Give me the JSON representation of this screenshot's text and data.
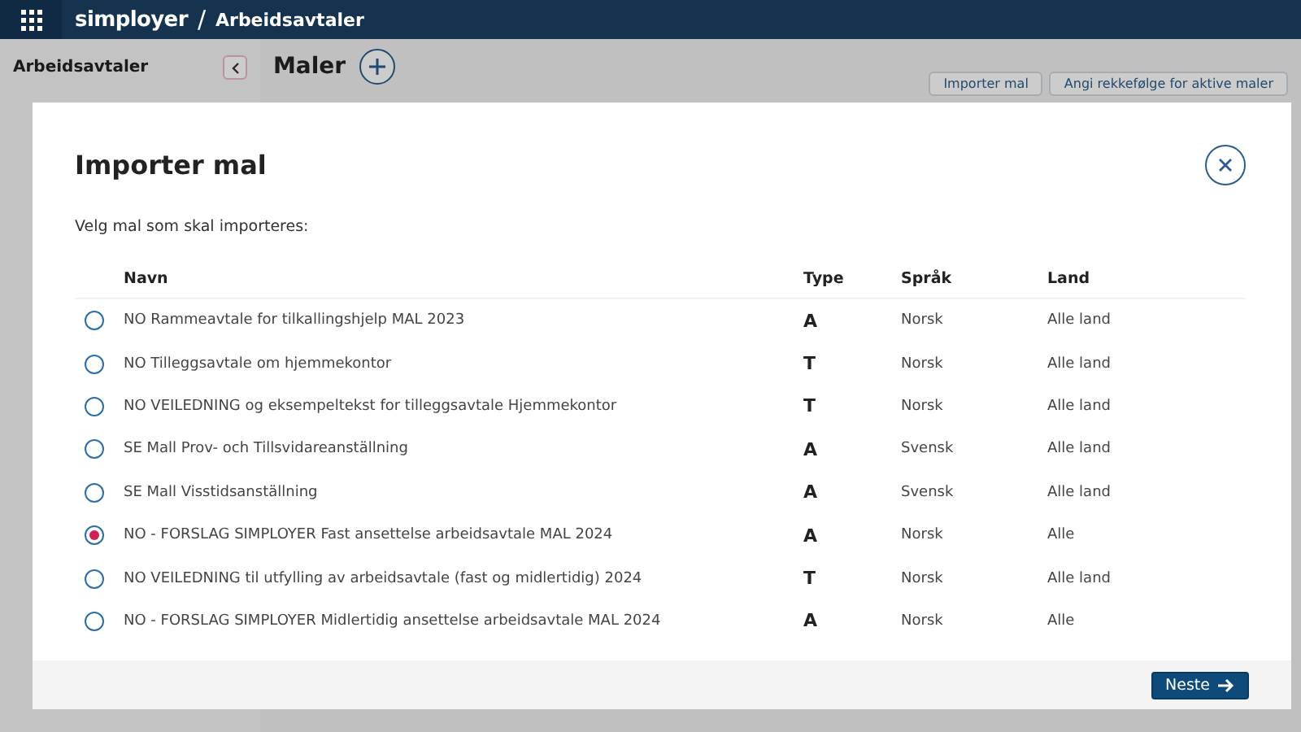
{
  "topbar": {
    "logo": "simployer",
    "separator": "/",
    "title": "Arbeidsavtaler"
  },
  "sidebar": {
    "title": "Arbeidsavtaler"
  },
  "page": {
    "heading": "Maler",
    "buttons": [
      "Importer mal",
      "Angi rekkefølge for aktive maler"
    ]
  },
  "dialog": {
    "title": "Importer mal",
    "subtitle": "Velg mal som skal importeres:",
    "columns": [
      "Navn",
      "Type",
      "Språk",
      "Land"
    ],
    "rows": [
      {
        "name": "NO Rammeavtale for tilkallingshjelp MAL 2023",
        "type": "A",
        "language": "Norsk",
        "country": "Alle land",
        "selected": false
      },
      {
        "name": "NO Tilleggsavtale om hjemmekontor",
        "type": "T",
        "language": "Norsk",
        "country": "Alle land",
        "selected": false
      },
      {
        "name": "NO VEILEDNING og eksempeltekst for tilleggsavtale Hjemmekontor",
        "type": "T",
        "language": "Norsk",
        "country": "Alle land",
        "selected": false
      },
      {
        "name": "SE Mall Prov- och Tillsvidareanställning",
        "type": "A",
        "language": "Svensk",
        "country": "Alle land",
        "selected": false
      },
      {
        "name": "SE Mall Visstidsanställning",
        "type": "A",
        "language": "Svensk",
        "country": "Alle land",
        "selected": false
      },
      {
        "name": "NO - FORSLAG SIMPLOYER Fast ansettelse arbeidsavtale MAL 2024",
        "type": "A",
        "language": "Norsk",
        "country": "Alle",
        "selected": true
      },
      {
        "name": "NO VEILEDNING til utfylling av arbeidsavtale (fast og midlertidig) 2024",
        "type": "T",
        "language": "Norsk",
        "country": "Alle land",
        "selected": false
      },
      {
        "name": "NO - FORSLAG SIMPLOYER Midlertidig ansettelse arbeidsavtale MAL 2024",
        "type": "A",
        "language": "Norsk",
        "country": "Alle",
        "selected": false
      }
    ],
    "next_button": "Neste"
  }
}
